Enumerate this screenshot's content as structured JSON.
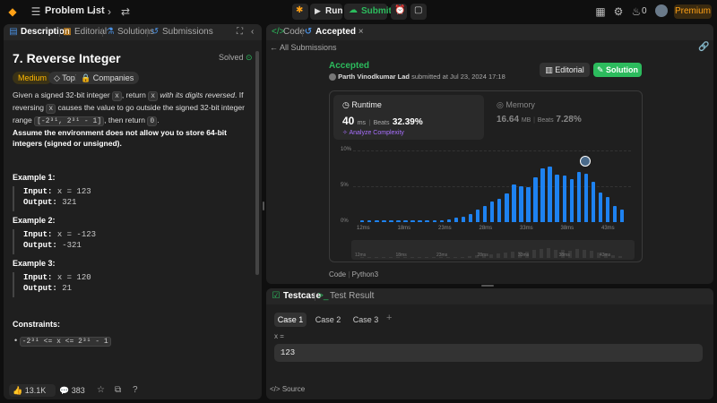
{
  "topbar": {
    "problem_list": "Problem List",
    "run": "Run",
    "submit": "Submit",
    "streak": "0",
    "premium": "Premium"
  },
  "left": {
    "tabs": [
      "Description",
      "Editorial",
      "Solutions",
      "Submissions"
    ],
    "title": "7. Reverse Integer",
    "status": "Solved",
    "tags": [
      "Medium",
      "Topics",
      "Companies"
    ],
    "desc_p1_a": "Given a signed 32-bit integer",
    "desc_code_x": "x",
    "desc_p1_b": ", return",
    "desc_p1_c": "with its digits reversed",
    "desc_p1_d": ". If reversing",
    "desc_p2_a": "causes the value to go outside the signed 32-bit integer range",
    "desc_range": "[-2³¹, 2³¹ - 1]",
    "desc_p3_a": "then return",
    "desc_code_zero": "0",
    "assume": "Assume the environment does not allow you to store 64-bit integers (signed or unsigned).",
    "examples": [
      {
        "title": "Example 1:",
        "input": "x = 123",
        "output": "321"
      },
      {
        "title": "Example 2:",
        "input": "x = -123",
        "output": "-321"
      },
      {
        "title": "Example 3:",
        "input": "x = 120",
        "output": "21"
      }
    ],
    "input_label": "Input:",
    "output_label": "Output:",
    "constraints_title": "Constraints:",
    "constraint": "-2³¹ <= x <= 2³¹ - 1",
    "likes": "13.1K",
    "comments": "383"
  },
  "right": {
    "tabs": [
      "Code",
      "Accepted"
    ],
    "back": "All Submissions",
    "accepted": "Accepted",
    "author": "Parth Vinodkumar Lad",
    "submitted": "submitted at Jul 23, 2024 17:18",
    "editorial": "Editorial",
    "solution": "Solution",
    "runtime_label": "Runtime",
    "runtime_value": "40",
    "runtime_unit": "ms",
    "runtime_beats_label": "Beats",
    "runtime_beats": "32.39%",
    "analyze": "Analyze Complexity",
    "memory_label": "Memory",
    "memory_value": "16.64",
    "memory_unit": "MB",
    "memory_beats_label": "Beats",
    "memory_beats": "7.28%",
    "code_label": "Code",
    "lang": "Python3"
  },
  "chart_data": {
    "type": "bar",
    "y_ticks": [
      "10%",
      "5%",
      "0%"
    ],
    "x_ticks": [
      "12ms",
      "18ms",
      "23ms",
      "28ms",
      "33ms",
      "38ms",
      "43ms"
    ],
    "values": [
      0.2,
      0.2,
      0.2,
      0.2,
      0.2,
      0.2,
      0.2,
      0.2,
      0.2,
      0.2,
      0.3,
      0.3,
      0.4,
      0.6,
      0.8,
      1.1,
      1.8,
      2.3,
      2.9,
      3.3,
      4.0,
      5.3,
      5.0,
      4.9,
      6.3,
      7.5,
      7.8,
      6.6,
      6.5,
      6.0,
      7.0,
      6.7,
      5.6,
      4.1,
      3.5,
      2.3,
      1.7
    ],
    "ylim": [
      0,
      10
    ]
  },
  "testcase": {
    "tabs": [
      "Testcase",
      "Test Result"
    ],
    "cases": [
      "Case 1",
      "Case 2",
      "Case 3"
    ],
    "var_label": "x =",
    "var_value": "123",
    "source": "Source"
  }
}
